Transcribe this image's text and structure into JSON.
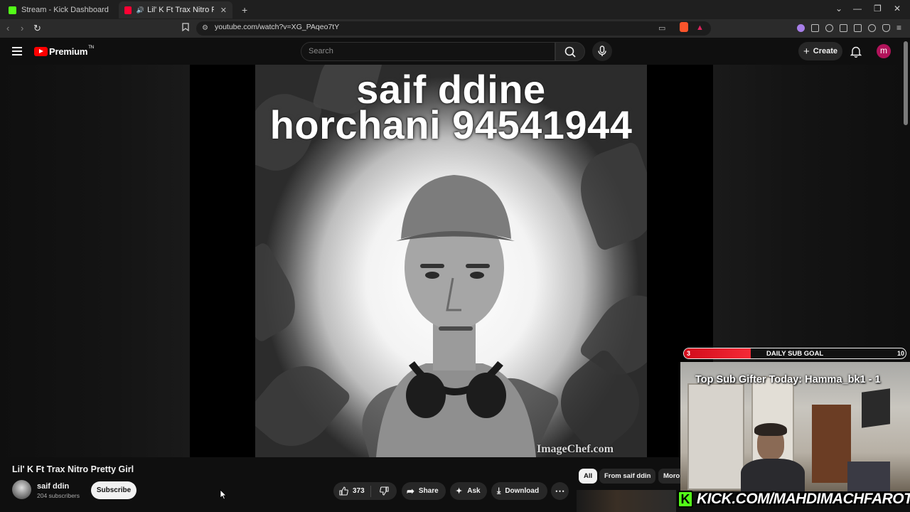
{
  "browser": {
    "tabs": [
      {
        "title": "Stream - Kick Dashboard",
        "favicon_color": "#53fc18"
      },
      {
        "title": "Lil' K Ft Trax Nitro Pretty Girl",
        "favicon_color": "#ff0033",
        "active": true
      }
    ],
    "new_tab_glyph": "+",
    "url": "youtube.com/watch?v=XG_PAqeo7tY"
  },
  "youtube": {
    "brand": "Premium",
    "brand_suffix": "TN",
    "search_placeholder": "Search",
    "create_label": "Create",
    "account_initial": "m"
  },
  "video": {
    "overlay_line1": "saif ddine",
    "overlay_line2": "horchani 94541944",
    "watermark": "ImageChef.com",
    "title": "Lil' K Ft Trax Nitro Pretty Girl",
    "channel_name": "saif ddin",
    "subscribers": "204 subscribers",
    "subscribe_label": "Subscribe",
    "likes": "373",
    "share_label": "Share",
    "ask_label": "Ask",
    "download_label": "Download"
  },
  "chips": [
    {
      "label": "All",
      "selected": true
    },
    {
      "label": "From saif ddin"
    },
    {
      "label": "Moro"
    }
  ],
  "stream_overlay": {
    "goal_current": "3",
    "goal_label": "DAILY SUB GOAL",
    "goal_target": "10",
    "goal_progress": 0.3,
    "top_gifter": "Top Sub Gifter Today: Hamma_bk1 - 1",
    "kick_url": "KICK.COM/MAHDIMACHFAROTB",
    "kick_logo_letter": "K"
  },
  "colors": {
    "youtube_red": "#ff0000",
    "kick_green": "#53fc18",
    "goal_red": "#e0141f"
  }
}
